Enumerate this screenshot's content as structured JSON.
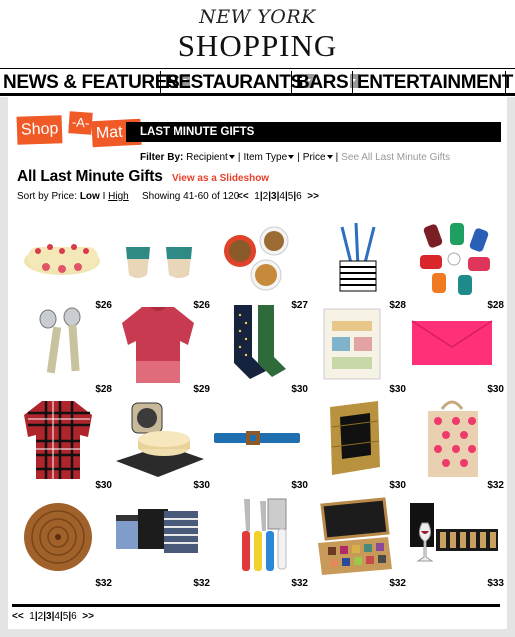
{
  "masthead": {
    "brand": "NEW YORK",
    "section": "SHOPPING"
  },
  "nav": {
    "items": [
      "NEWS & FEATURES",
      "RESTAURANTS",
      "BARS",
      "ENTERTAINMENT"
    ]
  },
  "logo": {
    "part1": "Shop",
    "part2": "-A-",
    "part3": "Mat ic"
  },
  "banner": {
    "title": "LAST MINUTE GIFTS"
  },
  "filters": {
    "label": "Filter By:",
    "options": [
      "Recipient",
      "Item Type",
      "Price"
    ],
    "see_all": "See All Last Minute Gifts"
  },
  "heading": {
    "title": "All Last Minute Gifts",
    "slideshow_link": "View as a Slideshow"
  },
  "sort": {
    "label": "Sort by Price:",
    "low": "Low",
    "sep": "I",
    "high": "High",
    "showing": "Showing 41-60 of 120"
  },
  "pagination": {
    "prev": "<<",
    "pages": [
      "1",
      "2",
      "3",
      "4",
      "5",
      "6"
    ],
    "current": "3",
    "next": ">>"
  },
  "products": [
    {
      "name": "yule-log-cake",
      "price": "$26"
    },
    {
      "name": "ceramic-cups",
      "price": "$26"
    },
    {
      "name": "snack-bowls",
      "price": "$27"
    },
    {
      "name": "pencil-holder",
      "price": "$28"
    },
    {
      "name": "luggage-tags",
      "price": "$28"
    },
    {
      "name": "salad-servers",
      "price": "$28"
    },
    {
      "name": "red-sweater",
      "price": "$29"
    },
    {
      "name": "dotted-socks",
      "price": "$30"
    },
    {
      "name": "home-book",
      "price": "$30"
    },
    {
      "name": "pink-clutch",
      "price": "$30"
    },
    {
      "name": "plaid-shirt",
      "price": "$30"
    },
    {
      "name": "cheese-board",
      "price": "$30"
    },
    {
      "name": "blue-belt",
      "price": "$30"
    },
    {
      "name": "picture-frame",
      "price": "$30"
    },
    {
      "name": "polka-dot-tote",
      "price": "$32"
    },
    {
      "name": "wood-cutting-board",
      "price": "$32"
    },
    {
      "name": "boxer-briefs",
      "price": "$32"
    },
    {
      "name": "cheese-knives",
      "price": "$32"
    },
    {
      "name": "eyeshadow-palette",
      "price": "$32"
    },
    {
      "name": "wine-set",
      "price": "$33"
    }
  ],
  "colors": {
    "accent": "#ef5a27",
    "link": "#e8402a",
    "frame": "#e4e4e4"
  }
}
